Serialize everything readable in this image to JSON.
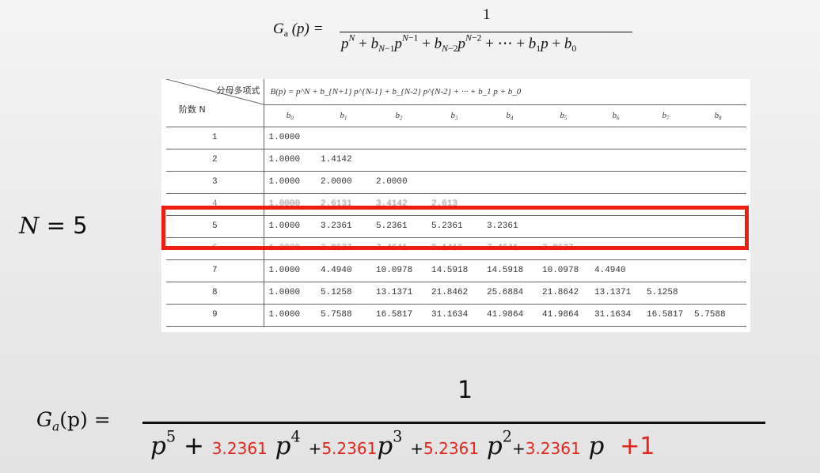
{
  "top_formula": {
    "numerator": "1",
    "lhs_text": "G",
    "lhs_sub": "a",
    "lhs_arg": "(p) =",
    "denominator": "p^N + b_{N-1}p^{N-1} + b_{N-2}p^{N-2} + ··· + b_1p + b_0"
  },
  "table": {
    "corner_top": "分母多项式",
    "corner_bottom": "阶数 N",
    "poly_header": "B(p) = p^N + b_{N+1} p^{N-1} + b_{N-2} p^{N-2} + ··· + b_1 p + b_0",
    "coef_headers": [
      "b0",
      "b1",
      "b2",
      "b3",
      "b4",
      "b5",
      "b6",
      "b7",
      "b8"
    ],
    "rows": [
      {
        "n": "1",
        "values": [
          "1.0000"
        ]
      },
      {
        "n": "2",
        "values": [
          "1.0000",
          "1.4142"
        ]
      },
      {
        "n": "3",
        "values": [
          "1.0000",
          "2.0000",
          "2.0000"
        ]
      },
      {
        "n": "4",
        "values": [
          "1.0000",
          "2.6131",
          "3.4142",
          "2.613"
        ]
      },
      {
        "n": "5",
        "values": [
          "1.0000",
          "3.2361",
          "5.2361",
          "5.2361",
          "3.2361"
        ]
      },
      {
        "n": "6",
        "values": [
          "1.0000",
          "3.8637",
          "7.4641",
          "9.1416",
          "7.4641",
          "3.8637"
        ]
      },
      {
        "n": "7",
        "values": [
          "1.0000",
          "4.4940",
          "10.0978",
          "14.5918",
          "14.5918",
          "10.0978",
          "4.4940"
        ]
      },
      {
        "n": "8",
        "values": [
          "1.0000",
          "5.1258",
          "13.1371",
          "21.8462",
          "25.6884",
          "21.8642",
          "13.1371",
          "5.1258"
        ]
      },
      {
        "n": "9",
        "values": [
          "1.0000",
          "5.7588",
          "16.5817",
          "31.1634",
          "41.9864",
          "41.9864",
          "31.1634",
          "16.5817",
          "5.7588"
        ]
      }
    ]
  },
  "n_label": {
    "var": "N",
    "rest": " = 5"
  },
  "bottom_formula": {
    "lhs": "G",
    "lhs_sub": "a",
    "lhs_rest": "(p) =",
    "numerator": "1",
    "c4": "3.2361",
    "c3": "5.2361",
    "c2": "5.2361",
    "c1": "3.2361",
    "c0": "+1"
  },
  "colors": {
    "highlight": "#ef1c10",
    "coefficient": "#e1261c"
  }
}
